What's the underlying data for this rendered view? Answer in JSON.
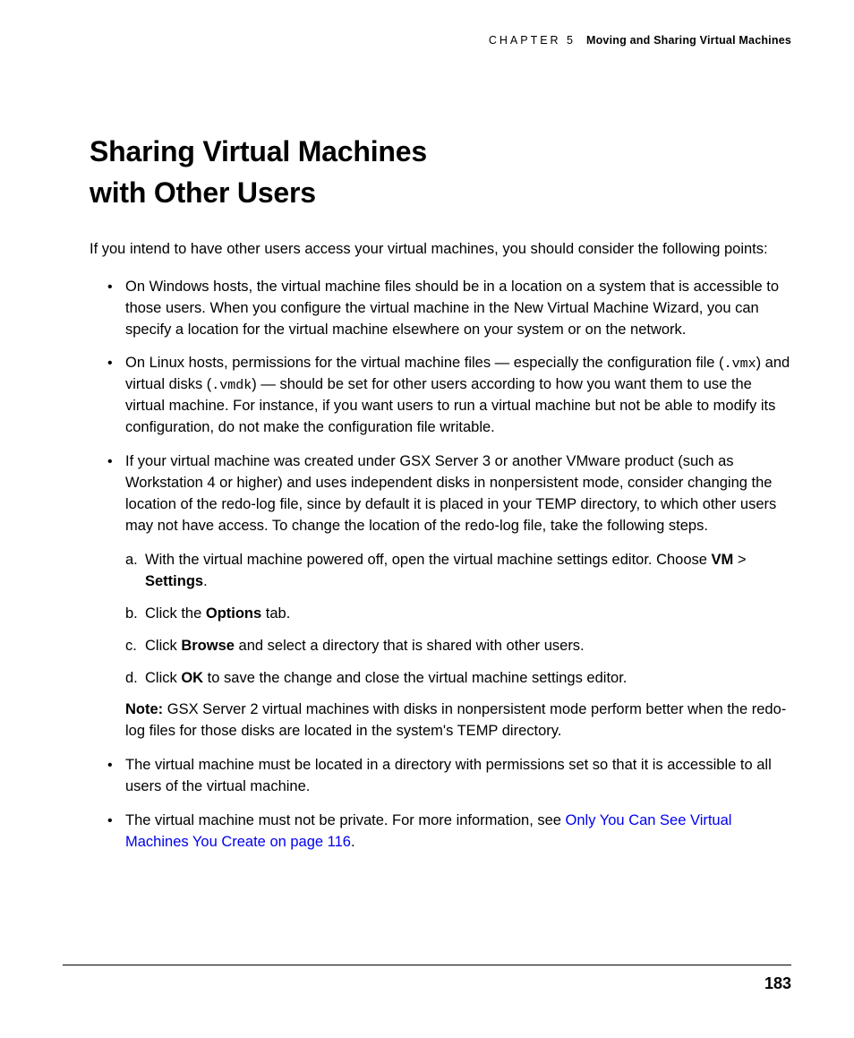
{
  "header": {
    "chapter_label": "CHAPTER 5",
    "chapter_title": "Moving and Sharing Virtual Machines"
  },
  "title_line1": "Sharing Virtual Machines",
  "title_line2": "with Other Users",
  "intro": "If you intend to have other users access your virtual machines, you should consider the following points:",
  "bullets": {
    "b1": "On Windows hosts, the virtual machine files should be in a location on a system that is accessible to those users. When you configure the virtual machine in the New Virtual Machine Wizard, you can specify a location for the virtual machine elsewhere on your system or on the network.",
    "b2_pre": "On Linux hosts, permissions for the virtual machine files — especially the configuration file (",
    "b2_code1": ".vmx",
    "b2_mid": ") and virtual disks (",
    "b2_code2": ".vmdk",
    "b2_post": ") — should be set for other users according to how you want them to use the virtual machine. For instance, if you want users to run a virtual machine but not be able to modify its configuration, do not make the configuration file writable.",
    "b3": "If your virtual machine was created under GSX Server 3 or another VMware product (such as Workstation 4 or higher) and uses independent disks in nonpersistent mode, consider changing the location of the redo-log file, since by default it is placed in your TEMP directory, to which other users may not have access. To change the location of the redo-log file, take the following steps.",
    "steps": {
      "a_marker": "a.",
      "a_pre": "With the virtual machine powered off, open the virtual machine settings editor. Choose ",
      "a_bold1": "VM",
      "a_sep": " > ",
      "a_bold2": "Settings",
      "a_post": ".",
      "b_marker": "b.",
      "b_pre": "Click the ",
      "b_bold": "Options",
      "b_post": " tab.",
      "c_marker": "c.",
      "c_pre": "Click ",
      "c_bold": "Browse",
      "c_post": " and select a directory that is shared with other users.",
      "d_marker": "d.",
      "d_pre": "Click ",
      "d_bold": "OK",
      "d_post": " to save the change and close the virtual machine settings editor."
    },
    "note_label": "Note:",
    "note_text": "  GSX Server 2 virtual machines with disks in nonpersistent mode perform better when the redo-log files for those disks are located in the system's TEMP directory.",
    "b4": "The virtual machine must be located in a directory with permissions set so that it is accessible to all users of the virtual machine.",
    "b5_pre": "The virtual machine must not be private. For more information, see ",
    "b5_link": "Only You Can See Virtual Machines You Create on page 116",
    "b5_post": "."
  },
  "page_number": "183"
}
